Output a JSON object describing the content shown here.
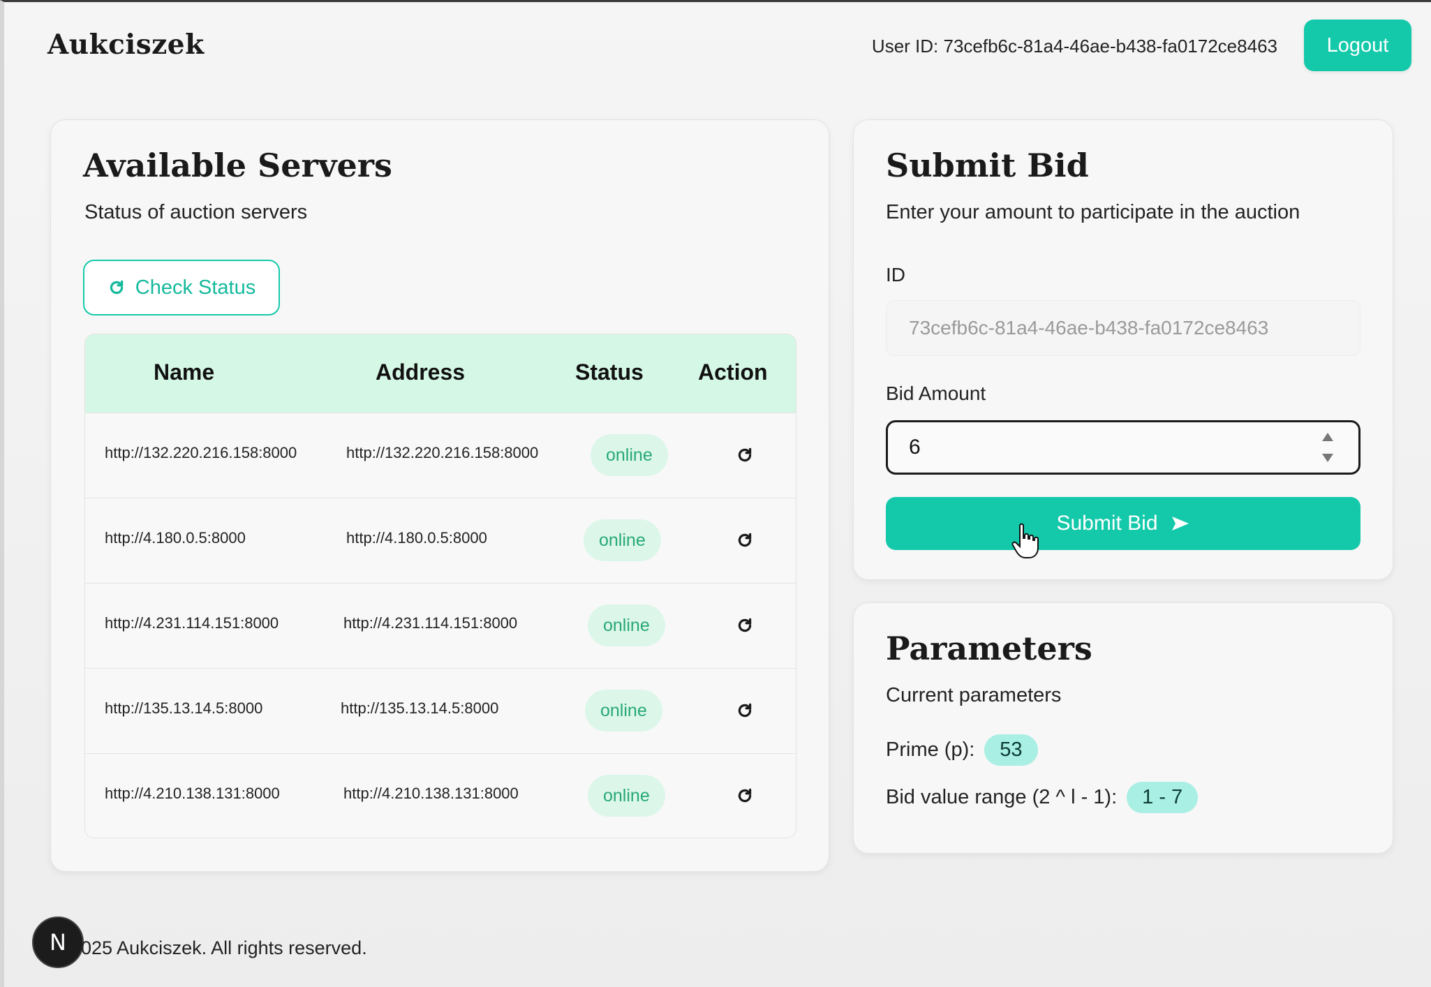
{
  "header": {
    "brand": "Aukciszek",
    "user_id": "User ID: 73cefb6c-81a4-46ae-b438-fa0172ce8463",
    "logout_label": "Logout"
  },
  "servers": {
    "title": "Available Servers",
    "subtitle": "Status of auction servers",
    "check_label": "Check Status",
    "columns": [
      "Name",
      "Address",
      "Status",
      "Action"
    ],
    "rows": [
      {
        "name": "http://132.220.216.158:8000",
        "address": "http://132.220.216.158:8000",
        "status": "online"
      },
      {
        "name": "http://4.180.0.5:8000",
        "address": "http://4.180.0.5:8000",
        "status": "online"
      },
      {
        "name": "http://4.231.114.151:8000",
        "address": "http://4.231.114.151:8000",
        "status": "online"
      },
      {
        "name": "http://135.13.14.5:8000",
        "address": "http://135.13.14.5:8000",
        "status": "online"
      },
      {
        "name": "http://4.210.138.131:8000",
        "address": "http://4.210.138.131:8000",
        "status": "online"
      }
    ]
  },
  "bid": {
    "title": "Submit Bid",
    "subtitle": "Enter your amount to participate in the auction",
    "id_label": "ID",
    "id_value": "73cefb6c-81a4-46ae-b438-fa0172ce8463",
    "amount_label": "Bid Amount",
    "amount_value": "6",
    "submit_label": "Submit Bid"
  },
  "params": {
    "title": "Parameters",
    "subtitle": "Current parameters",
    "prime_label": "Prime (p):",
    "prime_value": "53",
    "range_label": "Bid value range (2 ^ l - 1):",
    "range_value": "1 - 7"
  },
  "footer": {
    "text": "025 Aukciszek. All rights reserved.",
    "badge_letter": "N"
  },
  "colors": {
    "accent": "#14c9aa",
    "header_row": "#d5f7e6",
    "online_badge": "#dcf7ea",
    "pill": "#a9efe3"
  }
}
